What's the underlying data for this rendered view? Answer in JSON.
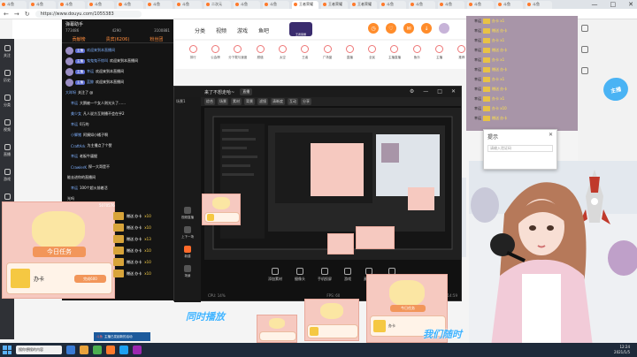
{
  "browser": {
    "tabs": [
      "斗鱼",
      "斗鱼",
      "斗鱼",
      "斗鱼",
      "斗鱼",
      "斗鱼",
      "斗鱼",
      "二次元",
      "斗鱼",
      "斗鱼",
      "王者荣耀",
      "王者荣耀",
      "王者荣耀",
      "斗鱼",
      "斗鱼",
      "斗鱼",
      "斗鱼",
      "斗鱼",
      "斗鱼"
    ],
    "url": "https://www.douyu.com/1055383",
    "window_controls": [
      "—",
      "□",
      "✕"
    ]
  },
  "header": {
    "nav": [
      "分类",
      "视频",
      "游戏",
      "鱼吧"
    ],
    "banner_badge": "王者荣耀"
  },
  "sidebar": {
    "items": [
      "关注",
      "历史",
      "分类",
      "视频",
      "直播",
      "游戏",
      "鱼吧",
      "更多"
    ]
  },
  "categories": [
    "排行",
    "公会榜",
    "分下载与速度",
    "颜值",
    "太空",
    "王者",
    "广场窗",
    "直播",
    "全民",
    "主播直播",
    "鱼乐",
    "主播",
    "推荐"
  ],
  "chat": {
    "title": "弹幕助手",
    "stats": [
      "773486",
      "4290",
      "3100881"
    ],
    "tabs": [
      "贡献榜",
      "贵宾(6206)",
      "粉丝团"
    ],
    "messages": [
      {
        "badge": "主播",
        "name": "欢迎来到本直播间",
        "msg": ""
      },
      {
        "badge": "主播",
        "name": "鬼鬼鬼不惊叫",
        "msg": "欢迎来到本直播间"
      },
      {
        "badge": "主播",
        "name": "幸运",
        "msg": "欢迎来到本直播间"
      },
      {
        "badge": "主播",
        "name": "蓝鲸",
        "msg": "欢迎来到本直播间"
      },
      {
        "badge": "",
        "name": "大咩呀",
        "msg": "关注了 @"
      },
      {
        "badge": "lv",
        "name": "幸运",
        "msg": "大鹅被一个女人则光头了……"
      },
      {
        "badge": "lv",
        "name": "美少女",
        "msg": "凡人说方互则播不会在乎2"
      },
      {
        "badge": "lv",
        "name": "幸运",
        "msg": "0万的"
      },
      {
        "badge": "lv",
        "name": "小脚猪",
        "msg": "阿姨如小橘子啊"
      },
      {
        "badge": "lv",
        "name": "CraftArk",
        "msg": "为主播点了个赞"
      },
      {
        "badge": "lv",
        "name": "幸运",
        "msg": "老板牛逼掘"
      },
      {
        "badge": "lv",
        "name": "CrawlerK",
        "msg": "探一大哥是不"
      },
      {
        "badge": "",
        "name": "",
        "msg": "能去进你的直播间"
      },
      {
        "badge": "lv",
        "name": "幸运",
        "msg": "100个超火前着活"
      },
      {
        "badge": "",
        "name": "",
        "msg": "光吗"
      }
    ]
  },
  "gifts": [
    {
      "label": "赠送 办卡",
      "count": "x10"
    },
    {
      "label": "赠送 办卡",
      "count": "x10"
    },
    {
      "label": "赠送 办卡",
      "count": "x13"
    },
    {
      "label": "赠送 办卡",
      "count": "x10"
    },
    {
      "label": "赠送 办卡",
      "count": "x10"
    },
    {
      "label": "赠送 办卡",
      "count": "x10"
    }
  ],
  "task_card": {
    "title": "今日任务",
    "card_label": "办卡",
    "button": "完成600",
    "level": "5070576"
  },
  "obs": {
    "title": "来了不想走哈~",
    "state": "直播",
    "toolbar": [
      "综合",
      "场景",
      "素材",
      "背景",
      "滤镜",
      "清晰度",
      "互动",
      "分享"
    ],
    "left_labels": [
      "场景1",
      "视频直播",
      "上一场",
      "上下一场",
      "新建",
      "场景"
    ],
    "bottom": [
      "添加素材",
      "摄像头",
      "手机投屏",
      "游戏",
      "麦克风",
      "扬声器"
    ],
    "status": [
      "CPU: 14%",
      "FPS: 60",
      "01:14:59"
    ]
  },
  "right_panel": {
    "rows": [
      {
        "user": "幸运",
        "text": "办卡 x1"
      },
      {
        "user": "幸运",
        "text": "赠送 办卡"
      },
      {
        "user": "幸运",
        "text": "办卡 x1"
      },
      {
        "user": "幸运",
        "text": "赠送 办卡"
      },
      {
        "user": "幸运",
        "text": "办卡 x1"
      },
      {
        "user": "幸运",
        "text": "赠送 办卡"
      },
      {
        "user": "幸运",
        "text": "办卡 x1"
      },
      {
        "user": "幸运",
        "text": "赠送 办卡"
      },
      {
        "user": "幸运",
        "text": "办卡 x1"
      },
      {
        "user": "幸运",
        "text": "办卡 x10"
      },
      {
        "user": "幸运",
        "text": "赠送 办卡"
      }
    ]
  },
  "dialog": {
    "title": "提示",
    "placeholder": "请输入验证码",
    "close": "✕"
  },
  "overlay": {
    "same_time": "同时播放",
    "follow": "我们随时"
  },
  "zhibo_badge": "主播",
  "taskbar": {
    "search": "搜你想搜的内容",
    "time": "12:24",
    "date": "2021/1/5"
  },
  "notification": {
    "prefix": "斗鱼",
    "text": "主播已发起新的活动"
  },
  "colors": {
    "accent": "#ff7a2c",
    "chat_bg": "#141414",
    "task_pink": "#f6c9c0",
    "badge_blue": "#5b6bd1"
  }
}
